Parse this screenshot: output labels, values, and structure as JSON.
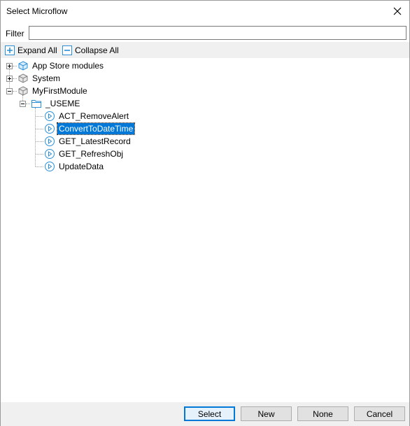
{
  "window": {
    "title": "Select Microflow",
    "close_icon": "close-icon"
  },
  "filter": {
    "label": "Filter",
    "value": "",
    "placeholder": ""
  },
  "toolbar": {
    "expand_all": "Expand All",
    "collapse_all": "Collapse All"
  },
  "tree": {
    "app_store": "App Store modules",
    "system": "System",
    "my_first_module": "MyFirstModule",
    "folder_useme": "_USEME",
    "microflows": [
      "ACT_RemoveAlert",
      "ConvertToDateTime",
      "GET_LatestRecord",
      "GET_RefreshObj",
      "UpdateData"
    ],
    "selected_microflow": "ConvertToDateTime"
  },
  "buttons": {
    "select": "Select",
    "new": "New",
    "none": "None",
    "cancel": "Cancel"
  },
  "colors": {
    "selection": "#0078d7",
    "toolbar_bg": "#f0f0f0",
    "module_icon": "#2a8fd8",
    "microflow_icon": "#2a8fd8"
  }
}
